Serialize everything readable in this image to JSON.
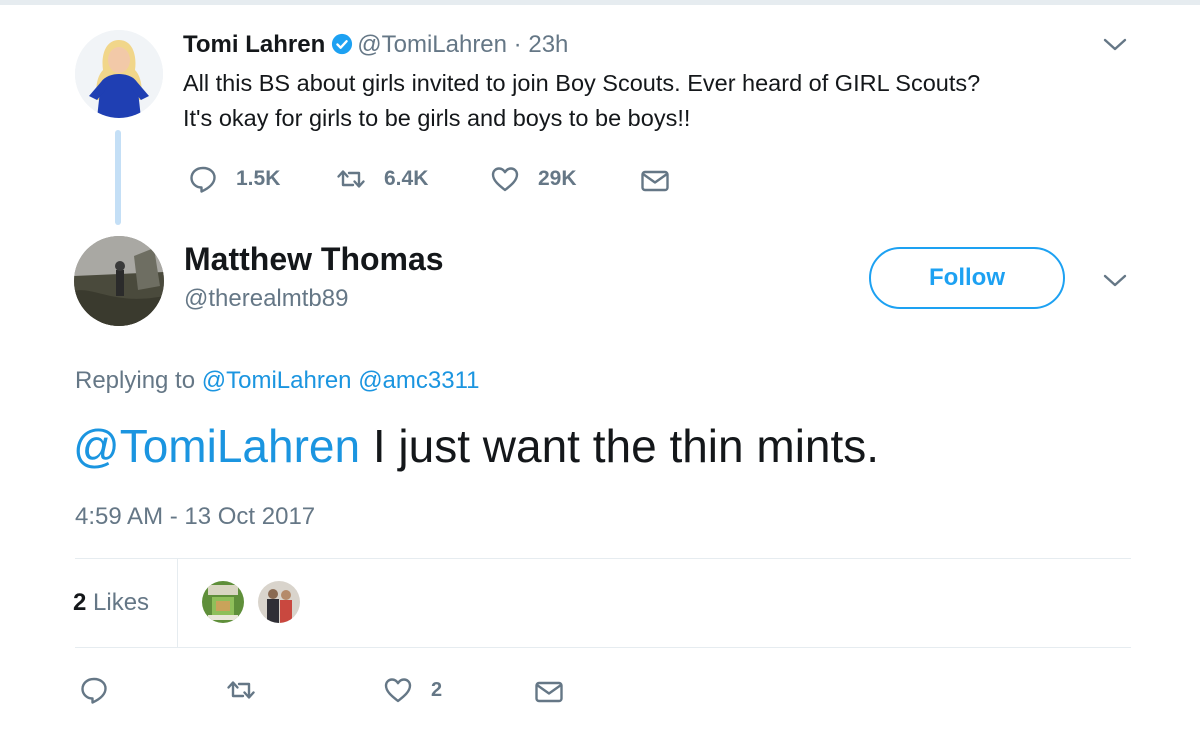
{
  "parent_tweet": {
    "name": "Tomi Lahren",
    "handle": "@TomiLahren",
    "separator": "·",
    "time": "23h",
    "text_line1": "All this BS about girls invited to join Boy Scouts. Ever heard of GIRL Scouts?",
    "text_line2": "It's okay for girls to be girls and boys to be boys!!",
    "replies": "1.5K",
    "retweets": "6.4K",
    "likes": "29K",
    "icons": {
      "verified": "verified-badge-icon",
      "reply": "reply-icon",
      "retweet": "retweet-icon",
      "like": "heart-icon",
      "dm": "envelope-icon",
      "menu": "chevron-down-icon"
    }
  },
  "reply_tweet": {
    "name": "Matthew Thomas",
    "handle": "@therealmtb89",
    "follow_label": "Follow",
    "replying_prefix": "Replying to",
    "replying_to_1": "@TomiLahren",
    "replying_to_2": "@amc3311",
    "mention": "@TomiLahren",
    "text": " I just want the thin mints.",
    "timestamp": "4:59 AM - 13 Oct 2017",
    "likes_count": "2",
    "likes_label": "Likes",
    "action_like_count": "2"
  },
  "colors": {
    "accent": "#1da1f2",
    "link": "#1b95e0",
    "muted": "#657786",
    "thread_line": "#c4dff6"
  }
}
